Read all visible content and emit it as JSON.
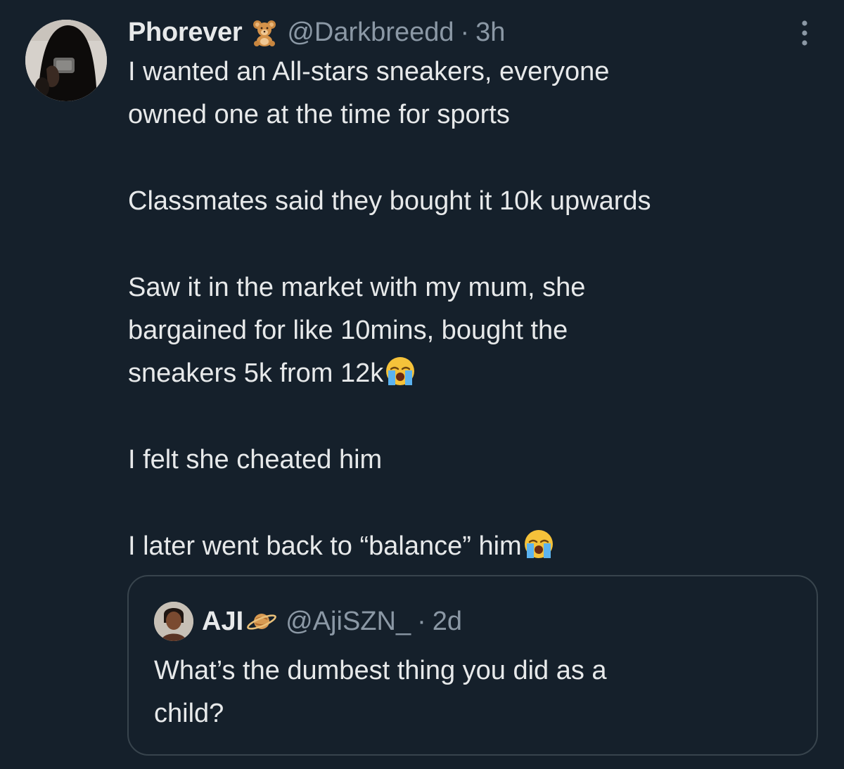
{
  "tweet": {
    "author": {
      "display_name": "Phorever",
      "name_emoji": "🧸",
      "handle": "@Darkbreedd",
      "separator": "·",
      "time": "3h",
      "avatar_icon": "avatar-person-icon"
    },
    "more_icon": "more-vertical-icon",
    "body": {
      "p1_line1": "I wanted an All-stars sneakers, everyone",
      "p1_line2": "owned one at the time for sports",
      "p2_line1": "Classmates said they bought it 10k upwards",
      "p3_line1": "Saw it in the market with my mum, she",
      "p3_line2": "bargained for like 10mins, bought the",
      "p3_line3": "sneakers 5k from 12k",
      "p4_line1": "I felt she cheated him",
      "p5_line1": "I later went back to “balance” him",
      "crying_emoji": "😭"
    },
    "quote": {
      "display_name": "AJI",
      "name_emoji": "🪐",
      "handle": "@AjiSZN_",
      "separator": "·",
      "time": "2d",
      "text_line1": "What’s the dumbest thing you did as a",
      "text_line2": "child?"
    }
  },
  "colors": {
    "background": "#15202b",
    "text_primary": "#e7e9ea",
    "text_secondary": "#8b98a5",
    "border": "#38444d"
  }
}
